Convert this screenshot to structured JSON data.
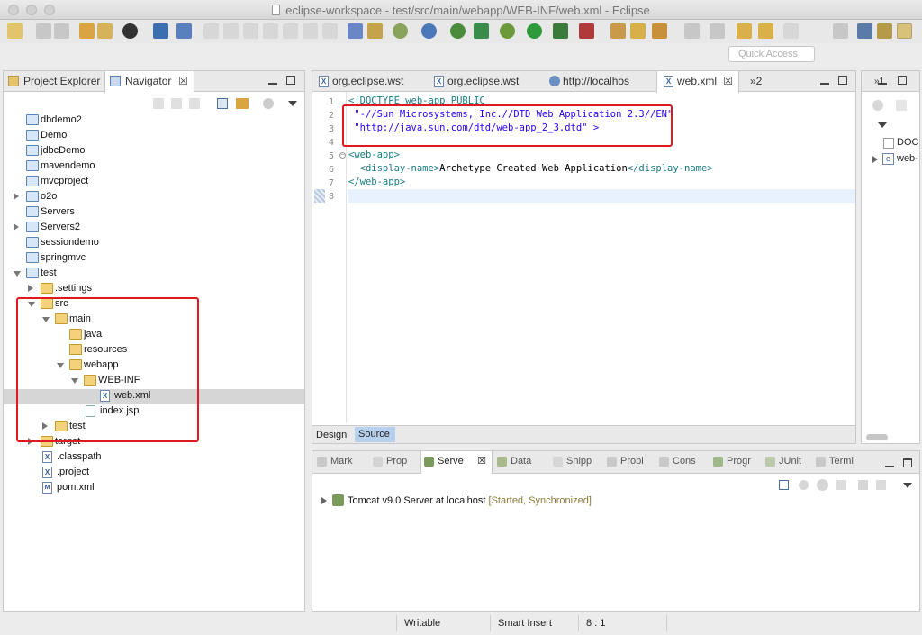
{
  "window": {
    "title": "eclipse-workspace - test/src/main/webapp/WEB-INF/web.xml - Eclipse"
  },
  "toolbar": {
    "quick_access_placeholder": "Quick Access"
  },
  "left_panel": {
    "tabs": [
      {
        "label": "Project Explorer"
      },
      {
        "label": "Navigator",
        "close": "☒"
      }
    ],
    "tree": [
      {
        "label": "dbdemo2"
      },
      {
        "label": "Demo"
      },
      {
        "label": "jdbcDemo"
      },
      {
        "label": "mavendemo"
      },
      {
        "label": "mvcproject"
      },
      {
        "label": "o2o"
      },
      {
        "label": "Servers"
      },
      {
        "label": "Servers2"
      },
      {
        "label": "sessiondemo"
      },
      {
        "label": "springmvc"
      },
      {
        "label": "test"
      },
      {
        "label": ".settings"
      },
      {
        "label": "src"
      },
      {
        "label": "main"
      },
      {
        "label": "java"
      },
      {
        "label": "resources"
      },
      {
        "label": "webapp"
      },
      {
        "label": "WEB-INF"
      },
      {
        "label": "web.xml"
      },
      {
        "label": "index.jsp"
      },
      {
        "label": "test"
      },
      {
        "label": "target"
      },
      {
        "label": ".classpath"
      },
      {
        "label": ".project"
      },
      {
        "label": "pom.xml"
      }
    ]
  },
  "editor": {
    "tabs": [
      {
        "label": "org.eclipse.wst"
      },
      {
        "label": "org.eclipse.wst"
      },
      {
        "label": "http://localhos"
      },
      {
        "label": "web.xml",
        "close": "☒"
      },
      {
        "label": "»2"
      }
    ],
    "line_numbers": [
      "1",
      "2",
      "3",
      "4",
      "5",
      "6",
      "7",
      "8"
    ],
    "lines": {
      "l1": "<!DOCTYPE web-app PUBLIC",
      "l2": " \"-//Sun Microsystems, Inc.//DTD Web Application 2.3//EN\"",
      "l3": " \"http://java.sun.com/dtd/web-app_2_3.dtd\" >",
      "l5_tag": "<web-app>",
      "l6_open": "  <display-name>",
      "l6_text": "Archetype Created Web Application",
      "l6_close": "</display-name>",
      "l7": "</web-app>"
    },
    "bottom_tabs": [
      {
        "label": "Design"
      },
      {
        "label": "Source"
      }
    ]
  },
  "bottom_panel": {
    "tabs": [
      {
        "label": "Mark"
      },
      {
        "label": "Prop"
      },
      {
        "label": "Serve",
        "close": "☒"
      },
      {
        "label": "Data"
      },
      {
        "label": "Snipp"
      },
      {
        "label": "Probl"
      },
      {
        "label": "Cons"
      },
      {
        "label": "Progr"
      },
      {
        "label": "JUnit"
      },
      {
        "label": "Termi"
      }
    ],
    "server": {
      "name": "Tomcat v9.0 Server at localhost",
      "status": "[Started, Synchronized]"
    }
  },
  "right_panel": {
    "tabs_label": "»1",
    "items": [
      {
        "label": "DOC"
      },
      {
        "label": "web-"
      }
    ]
  },
  "statusbar": {
    "writable": "Writable",
    "insert_mode": "Smart Insert",
    "position": "8 : 1"
  },
  "colors": {
    "highlight": "#e01820",
    "tag": "#177d82",
    "string": "#2a00ff"
  }
}
